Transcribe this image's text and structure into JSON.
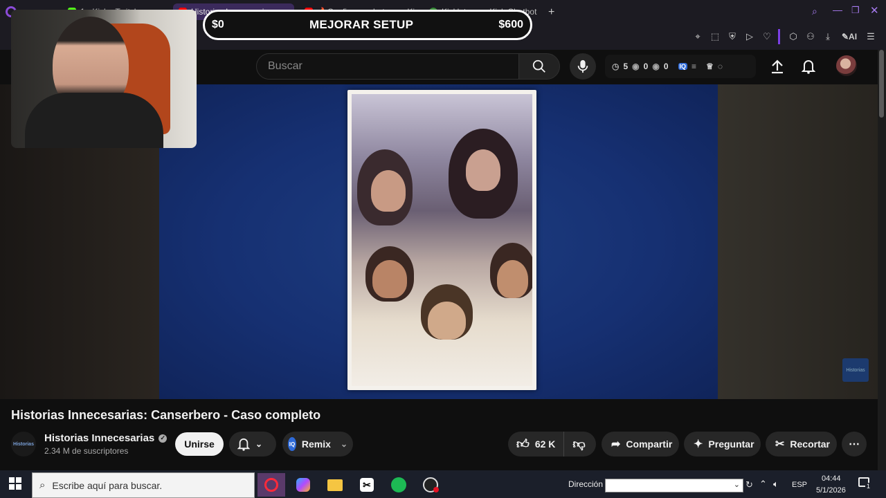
{
  "browser": {
    "tabs": [
      {
        "label": "1 · Kick · Twitch",
        "active": false
      },
      {
        "label": "Historias Innecesarias",
        "active": true
      },
      {
        "label": "🔥Configurar alertas en Ki",
        "active": false
      },
      {
        "label": "Kicklet.app - Kick Chatbot",
        "active": false
      }
    ],
    "ai_label": "AI"
  },
  "setup_banner": {
    "left_amount": "$0",
    "title": "MEJORAR SETUP",
    "right_amount": "$600"
  },
  "header": {
    "search_placeholder": "Buscar",
    "stats": {
      "clock": "5",
      "views": "0",
      "other": "0"
    }
  },
  "video": {
    "title": "Historias Innecesarias: Canserbero - Caso completo",
    "watermark": "Historias"
  },
  "channel": {
    "name": "Historias Innecesarias",
    "subscribers": "2.34 M de suscriptores",
    "avatar_text": "Historias",
    "join_label": "Unirse"
  },
  "actions": {
    "remix_label": "Remix",
    "likes": "62 K",
    "share_label": "Compartir",
    "ask_label": "Preguntar",
    "clip_label": "Recortar"
  },
  "taskbar": {
    "search_placeholder": "Escribe aquí para buscar.",
    "address_label": "Dirección",
    "language": "ESP",
    "time": "04:44",
    "date": "5/1/2026",
    "notification_count": "1"
  },
  "colors": {
    "accent": "#7b3fe4",
    "yt_bg": "#0f0f0f",
    "spotify": "#1db954"
  }
}
